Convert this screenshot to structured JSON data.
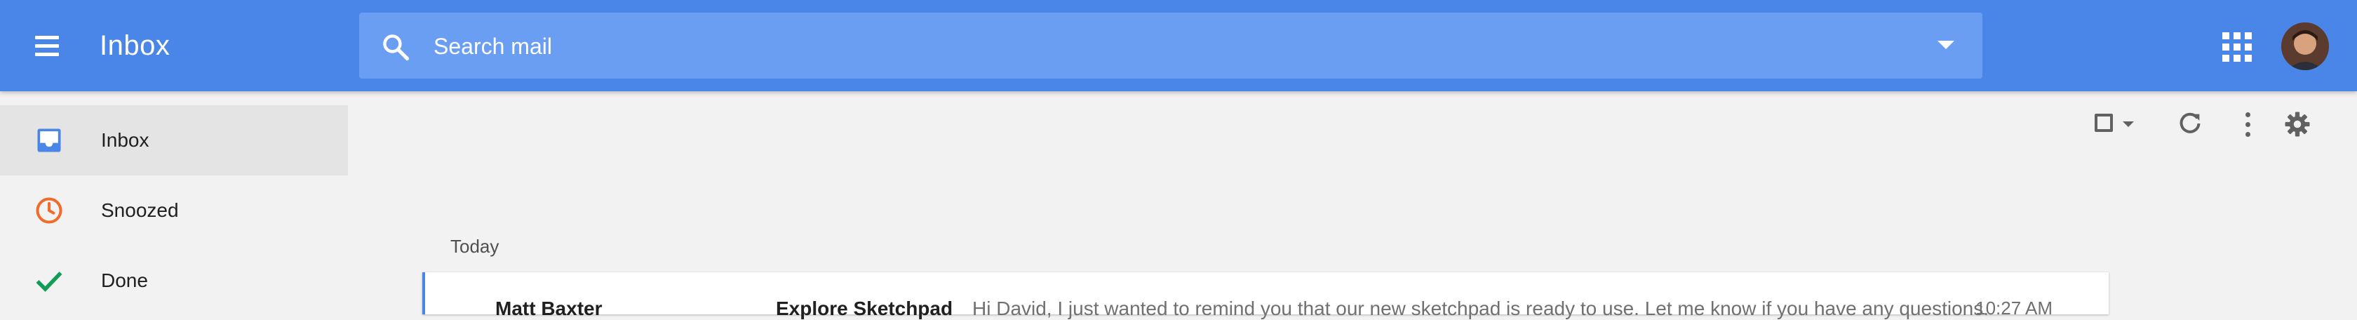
{
  "appbar": {
    "title": "Inbox",
    "search_placeholder": "Search mail",
    "colors": {
      "bar": "#4a86e8",
      "search": "#6a9ef2"
    },
    "icons": [
      "menu-icon",
      "search-icon",
      "dropdown-arrow-icon",
      "apps-grid-icon",
      "avatar"
    ]
  },
  "sidebar": {
    "items": [
      {
        "label": "Inbox",
        "icon": "inbox-icon",
        "color": "#4a86e8",
        "active": true
      },
      {
        "label": "Snoozed",
        "icon": "clock-icon",
        "color": "#ef6c2c",
        "active": false
      },
      {
        "label": "Done",
        "icon": "checkmark-icon",
        "color": "#0f9d58",
        "active": false
      }
    ]
  },
  "toolbar": {
    "icons": [
      "select-checkbox-icon",
      "refresh-icon",
      "more-vert-icon",
      "settings-gear-icon"
    ]
  },
  "main": {
    "section_label": "Today",
    "emails": [
      {
        "sender": "Matt Baxter",
        "subject": "Explore Sketchpad",
        "snippet": "Hi David, I just wanted to remind you that our new sketchpad is ready to use. Let me know if you have any questions.",
        "time": "10:27 AM"
      }
    ]
  }
}
